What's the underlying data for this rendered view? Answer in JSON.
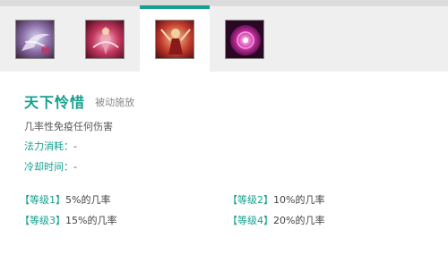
{
  "tabs": [
    {
      "icon": "skill-icon-1-swirl"
    },
    {
      "icon": "skill-icon-2-dancer"
    },
    {
      "icon": "skill-icon-3-warrior"
    },
    {
      "icon": "skill-icon-4-orb"
    }
  ],
  "active_tab": 2,
  "skill": {
    "name": "天下怜惜",
    "type": "被动施放",
    "description": "几率性免疫任何伤害",
    "mana_label": "法力消耗：",
    "mana_value": "-",
    "cooldown_label": "冷却时间：",
    "cooldown_value": "-"
  },
  "levels": [
    {
      "tag": "【等级1】",
      "text": "5%的几率"
    },
    {
      "tag": "【等级2】",
      "text": "10%的几率"
    },
    {
      "tag": "【等级3】",
      "text": "15%的几率"
    },
    {
      "tag": "【等级4】",
      "text": "20%的几率"
    }
  ],
  "colors": {
    "accent": "#16a08f",
    "tabbar_bg": "#efefef"
  }
}
